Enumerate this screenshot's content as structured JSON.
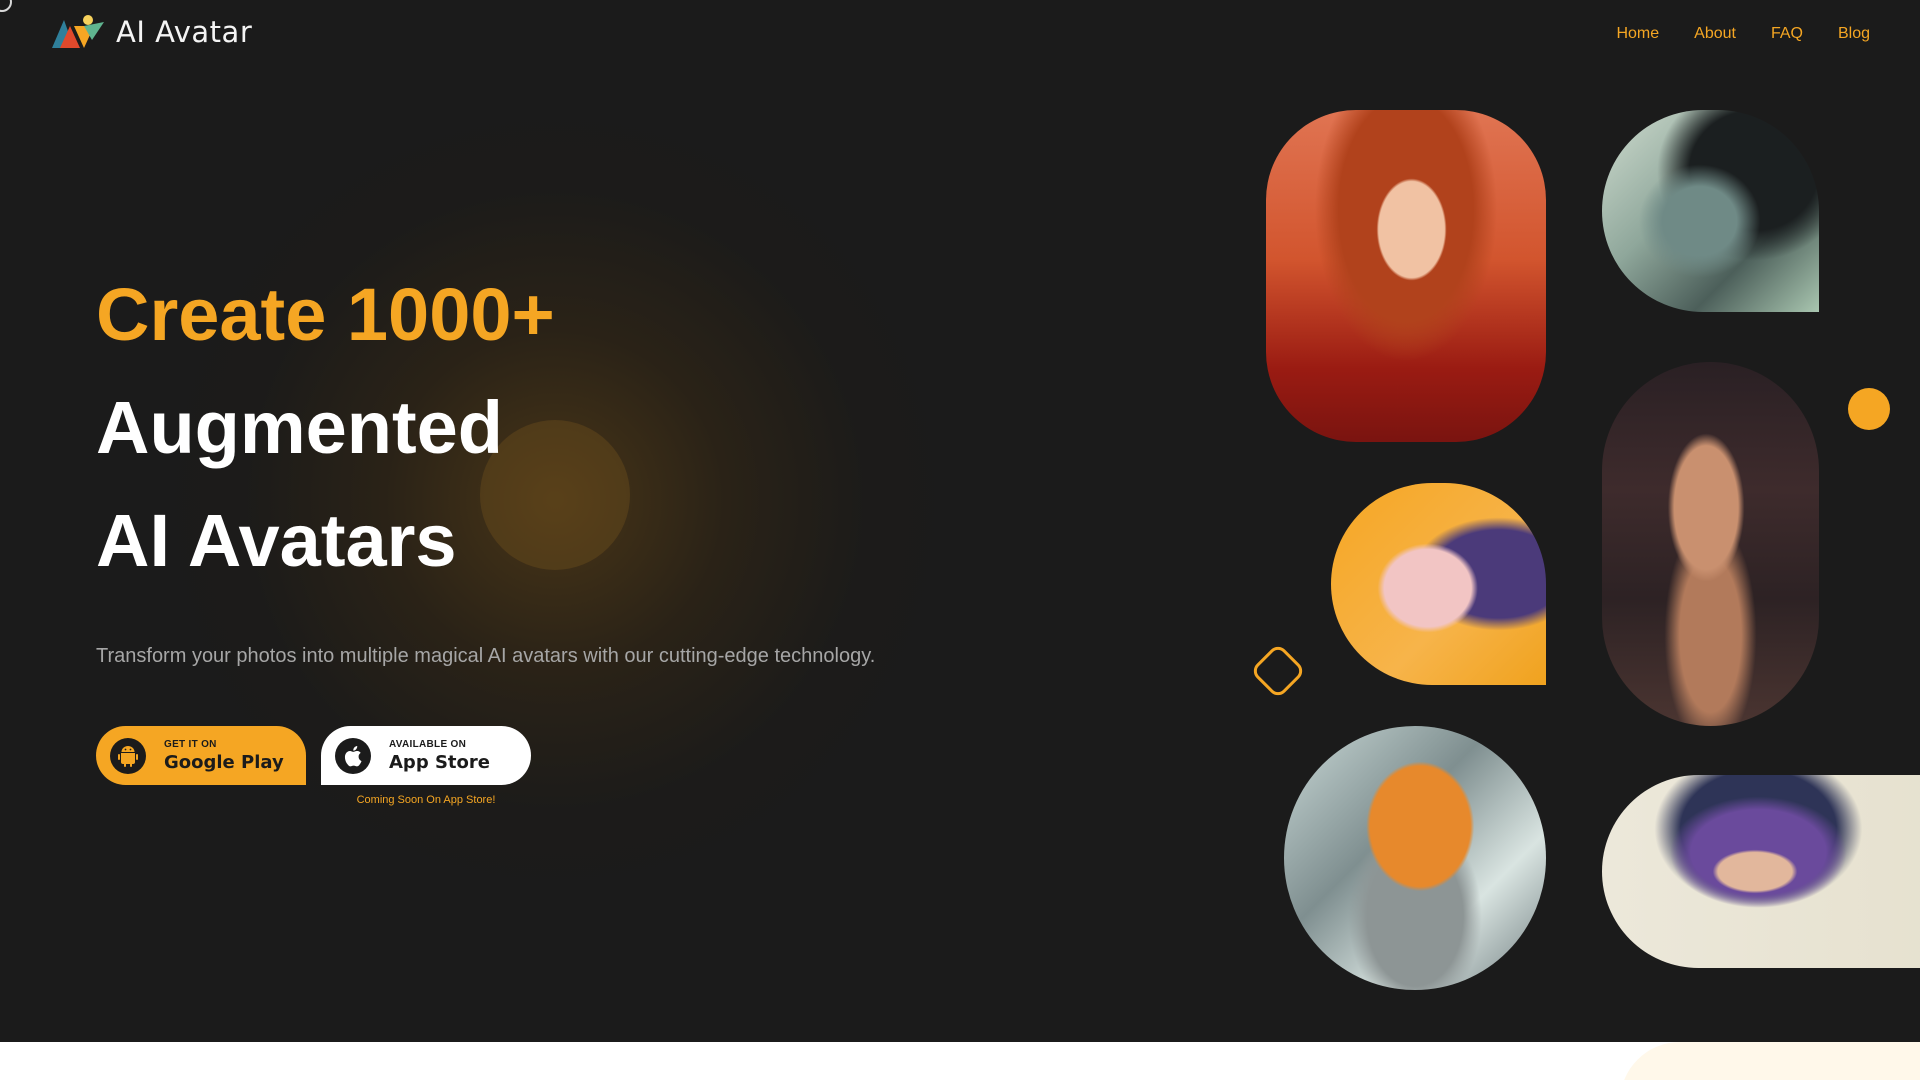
{
  "header": {
    "brand": "AI Avatar",
    "logo_icon": "ai-avatar-logo-icon",
    "nav": [
      {
        "label": "Home"
      },
      {
        "label": "About"
      },
      {
        "label": "FAQ"
      },
      {
        "label": "Blog"
      }
    ]
  },
  "hero": {
    "headline_accent": "Create 1000+",
    "headline_line2": "Augmented",
    "headline_line3": "AI Avatars",
    "subtitle": "Transform your photos into multiple magical AI avatars with our cutting-edge technology.",
    "google_play": {
      "small": "GET IT ON",
      "big": "Google Play",
      "icon": "android-icon"
    },
    "app_store": {
      "small": "AVAILABLE ON",
      "big": "App Store",
      "icon": "apple-icon"
    },
    "coming_soon": "Coming Soon On App Store!"
  },
  "colors": {
    "background": "#1b1b1b",
    "accent": "#f5a623",
    "text": "#ffffff",
    "muted": "#a6a6a6"
  }
}
